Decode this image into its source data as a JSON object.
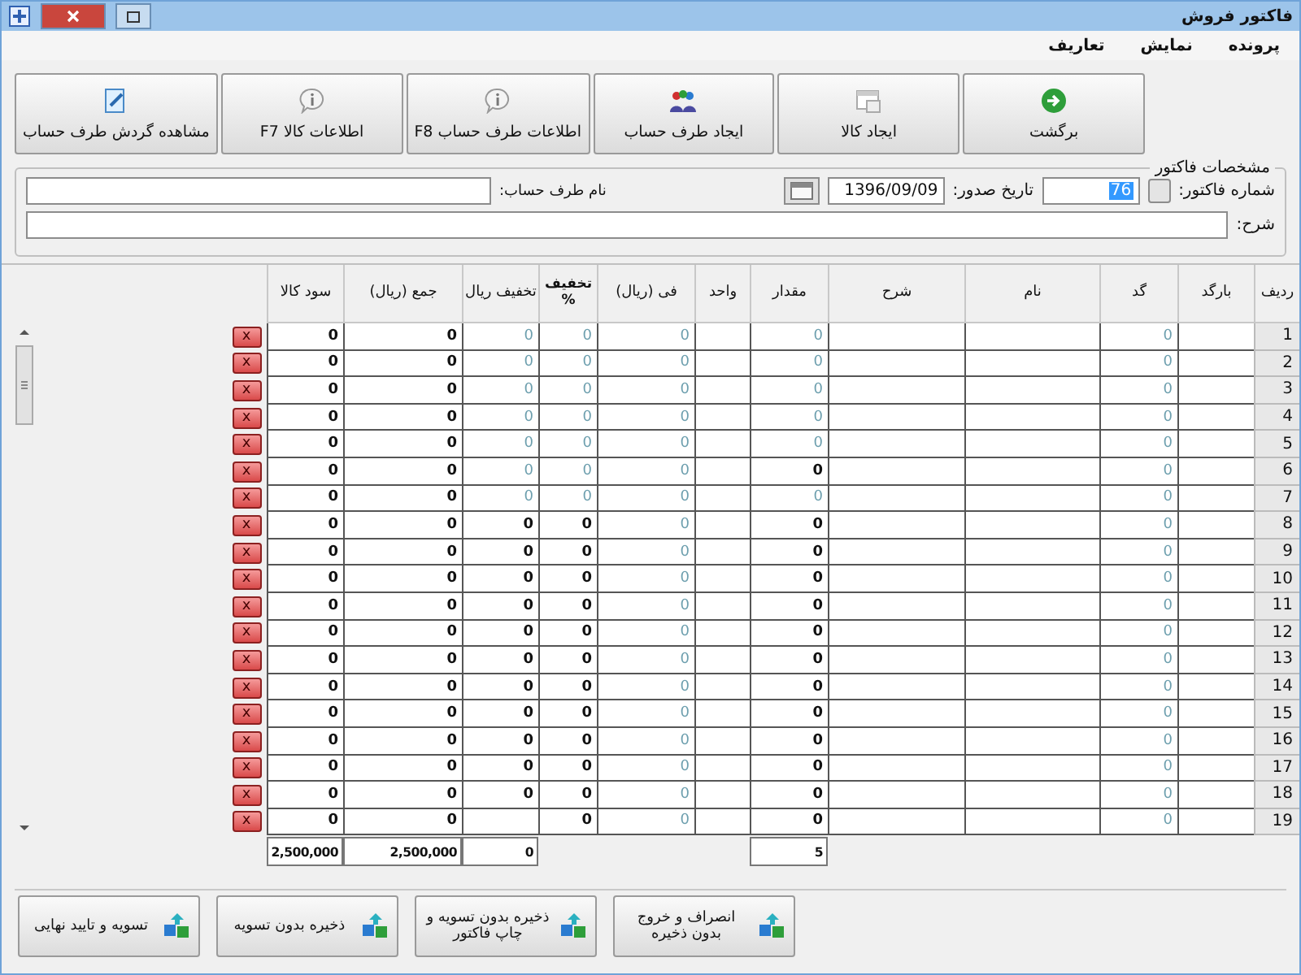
{
  "window": {
    "title": "فاکتور فروش"
  },
  "menu": [
    "پرونده",
    "نمایش",
    "تعاریف"
  ],
  "toolbar": [
    "برگشت",
    "ایجاد کالا",
    "ایجاد طرف حساب",
    "اطلاعات طرف حساب F8",
    "اطلاعات کالا F7",
    "مشاهده گردش طرف حساب"
  ],
  "invoice": {
    "legend": "مشخصات فاکتور",
    "number_label": "شماره فاکتور:",
    "number": "76",
    "number_highlighted": true,
    "date_label": "تاریخ صدور:",
    "date": "1396/09/09",
    "account_label": "نام طرف حساب:",
    "description_label": "شرح:"
  },
  "table": {
    "columns": [
      "ردیف",
      "بارگد",
      "گد",
      "نام",
      "شرح",
      "مقدار",
      "واحد",
      "فی (ریال)",
      "تخفیف %",
      "تخفیف ریال",
      "جمع (ریال)",
      "سود کالا"
    ],
    "rows": [
      {
        "delete": "x",
        "cells": [
          {
            "kind": "row_number",
            "text": "1"
          },
          {
            "kind": "empty"
          },
          {
            "kind": "value",
            "text": "0",
            "muted": true
          },
          {
            "kind": "empty"
          },
          {
            "kind": "empty"
          },
          {
            "kind": "value",
            "text": "0",
            "muted": true
          },
          {
            "kind": "empty"
          },
          {
            "kind": "value",
            "text": "0",
            "muted": true
          },
          {
            "kind": "value",
            "text": "0",
            "muted": true
          },
          {
            "kind": "value",
            "text": "0",
            "muted": true
          },
          {
            "kind": "value",
            "text": "0",
            "muted": false
          },
          {
            "kind": "value",
            "text": "0",
            "muted": false
          }
        ]
      },
      {
        "delete": "x",
        "cells": [
          {
            "kind": "row_number",
            "text": "2"
          },
          {
            "kind": "empty"
          },
          {
            "kind": "value",
            "text": "0",
            "muted": true
          },
          {
            "kind": "empty"
          },
          {
            "kind": "empty"
          },
          {
            "kind": "value",
            "text": "0",
            "muted": true
          },
          {
            "kind": "empty"
          },
          {
            "kind": "value",
            "text": "0",
            "muted": true
          },
          {
            "kind": "value",
            "text": "0",
            "muted": true
          },
          {
            "kind": "value",
            "text": "0",
            "muted": true
          },
          {
            "kind": "value",
            "text": "0",
            "muted": false
          },
          {
            "kind": "value",
            "text": "0",
            "muted": false
          }
        ]
      },
      {
        "delete": "x",
        "cells": [
          {
            "kind": "row_number",
            "text": "3"
          },
          {
            "kind": "empty"
          },
          {
            "kind": "value",
            "text": "0",
            "muted": true
          },
          {
            "kind": "empty"
          },
          {
            "kind": "empty"
          },
          {
            "kind": "value",
            "text": "0",
            "muted": true
          },
          {
            "kind": "empty"
          },
          {
            "kind": "value",
            "text": "0",
            "muted": true
          },
          {
            "kind": "value",
            "text": "0",
            "muted": true
          },
          {
            "kind": "value",
            "text": "0",
            "muted": true
          },
          {
            "kind": "value",
            "text": "0",
            "muted": false
          },
          {
            "kind": "value",
            "text": "0",
            "muted": false
          }
        ]
      },
      {
        "delete": "x",
        "cells": [
          {
            "kind": "row_number",
            "text": "4"
          },
          {
            "kind": "empty"
          },
          {
            "kind": "value",
            "text": "0",
            "muted": true
          },
          {
            "kind": "empty"
          },
          {
            "kind": "empty"
          },
          {
            "kind": "value",
            "text": "0",
            "muted": true
          },
          {
            "kind": "empty"
          },
          {
            "kind": "value",
            "text": "0",
            "muted": true
          },
          {
            "kind": "value",
            "text": "0",
            "muted": true
          },
          {
            "kind": "value",
            "text": "0",
            "muted": true
          },
          {
            "kind": "value",
            "text": "0",
            "muted": false
          },
          {
            "kind": "value",
            "text": "0",
            "muted": false
          }
        ]
      },
      {
        "delete": "x",
        "cells": [
          {
            "kind": "row_number",
            "text": "5"
          },
          {
            "kind": "empty"
          },
          {
            "kind": "value",
            "text": "0",
            "muted": true
          },
          {
            "kind": "empty"
          },
          {
            "kind": "empty"
          },
          {
            "kind": "value",
            "text": "0",
            "muted": true
          },
          {
            "kind": "empty"
          },
          {
            "kind": "value",
            "text": "0",
            "muted": true
          },
          {
            "kind": "value",
            "text": "0",
            "muted": true
          },
          {
            "kind": "value",
            "text": "0",
            "muted": true
          },
          {
            "kind": "value",
            "text": "0",
            "muted": false
          },
          {
            "kind": "value",
            "text": "0",
            "muted": false
          }
        ]
      },
      {
        "delete": "x",
        "cells": [
          {
            "kind": "row_number",
            "text": "6"
          },
          {
            "kind": "empty"
          },
          {
            "kind": "value",
            "text": "0",
            "muted": true
          },
          {
            "kind": "empty"
          },
          {
            "kind": "empty"
          },
          {
            "kind": "value",
            "text": "0",
            "muted": false
          },
          {
            "kind": "empty"
          },
          {
            "kind": "value",
            "text": "0",
            "muted": true
          },
          {
            "kind": "value",
            "text": "0",
            "muted": true
          },
          {
            "kind": "value",
            "text": "0",
            "muted": true
          },
          {
            "kind": "value",
            "text": "0",
            "muted": false
          },
          {
            "kind": "value",
            "text": "0",
            "muted": false
          }
        ]
      },
      {
        "delete": "x",
        "cells": [
          {
            "kind": "row_number",
            "text": "7"
          },
          {
            "kind": "empty"
          },
          {
            "kind": "value",
            "text": "0",
            "muted": true
          },
          {
            "kind": "empty"
          },
          {
            "kind": "empty"
          },
          {
            "kind": "value",
            "text": "0",
            "muted": true
          },
          {
            "kind": "empty"
          },
          {
            "kind": "value",
            "text": "0",
            "muted": true
          },
          {
            "kind": "value",
            "text": "0",
            "muted": true
          },
          {
            "kind": "value",
            "text": "0",
            "muted": true
          },
          {
            "kind": "value",
            "text": "0",
            "muted": false
          },
          {
            "kind": "value",
            "text": "0",
            "muted": false
          }
        ]
      },
      {
        "delete": "x",
        "cells": [
          {
            "kind": "row_number",
            "text": "8"
          },
          {
            "kind": "empty"
          },
          {
            "kind": "value",
            "text": "0",
            "muted": true
          },
          {
            "kind": "empty"
          },
          {
            "kind": "empty"
          },
          {
            "kind": "value",
            "text": "0",
            "muted": false
          },
          {
            "kind": "empty"
          },
          {
            "kind": "value",
            "text": "0",
            "muted": true
          },
          {
            "kind": "value",
            "text": "0",
            "muted": false
          },
          {
            "kind": "value",
            "text": "0",
            "muted": false
          },
          {
            "kind": "value",
            "text": "0",
            "muted": false
          },
          {
            "kind": "value",
            "text": "0",
            "muted": false
          }
        ]
      },
      {
        "delete": "x",
        "cells": [
          {
            "kind": "row_number",
            "text": "9"
          },
          {
            "kind": "empty"
          },
          {
            "kind": "value",
            "text": "0",
            "muted": true
          },
          {
            "kind": "empty"
          },
          {
            "kind": "empty"
          },
          {
            "kind": "value",
            "text": "0",
            "muted": false
          },
          {
            "kind": "empty"
          },
          {
            "kind": "value",
            "text": "0",
            "muted": true
          },
          {
            "kind": "value",
            "text": "0",
            "muted": false
          },
          {
            "kind": "value",
            "text": "0",
            "muted": false
          },
          {
            "kind": "value",
            "text": "0",
            "muted": false
          },
          {
            "kind": "value",
            "text": "0",
            "muted": false
          }
        ]
      },
      {
        "delete": "x",
        "cells": [
          {
            "kind": "row_number",
            "text": "10"
          },
          {
            "kind": "empty"
          },
          {
            "kind": "value",
            "text": "0",
            "muted": true
          },
          {
            "kind": "empty"
          },
          {
            "kind": "empty"
          },
          {
            "kind": "value",
            "text": "0",
            "muted": false
          },
          {
            "kind": "empty"
          },
          {
            "kind": "value",
            "text": "0",
            "muted": true
          },
          {
            "kind": "value",
            "text": "0",
            "muted": false
          },
          {
            "kind": "value",
            "text": "0",
            "muted": false
          },
          {
            "kind": "value",
            "text": "0",
            "muted": false
          },
          {
            "kind": "value",
            "text": "0",
            "muted": false
          }
        ]
      },
      {
        "delete": "x",
        "cells": [
          {
            "kind": "row_number",
            "text": "11"
          },
          {
            "kind": "empty"
          },
          {
            "kind": "value",
            "text": "0",
            "muted": true
          },
          {
            "kind": "empty"
          },
          {
            "kind": "empty"
          },
          {
            "kind": "value",
            "text": "0",
            "muted": false
          },
          {
            "kind": "empty"
          },
          {
            "kind": "value",
            "text": "0",
            "muted": true
          },
          {
            "kind": "value",
            "text": "0",
            "muted": false
          },
          {
            "kind": "value",
            "text": "0",
            "muted": false
          },
          {
            "kind": "value",
            "text": "0",
            "muted": false
          },
          {
            "kind": "value",
            "text": "0",
            "muted": false
          }
        ]
      },
      {
        "delete": "x",
        "cells": [
          {
            "kind": "row_number",
            "text": "12"
          },
          {
            "kind": "empty"
          },
          {
            "kind": "value",
            "text": "0",
            "muted": true
          },
          {
            "kind": "empty"
          },
          {
            "kind": "empty"
          },
          {
            "kind": "value",
            "text": "0",
            "muted": false
          },
          {
            "kind": "empty"
          },
          {
            "kind": "value",
            "text": "0",
            "muted": true
          },
          {
            "kind": "value",
            "text": "0",
            "muted": false
          },
          {
            "kind": "value",
            "text": "0",
            "muted": false
          },
          {
            "kind": "value",
            "text": "0",
            "muted": false
          },
          {
            "kind": "value",
            "text": "0",
            "muted": false
          }
        ]
      },
      {
        "delete": "x",
        "cells": [
          {
            "kind": "row_number",
            "text": "13"
          },
          {
            "kind": "empty"
          },
          {
            "kind": "value",
            "text": "0",
            "muted": true
          },
          {
            "kind": "empty"
          },
          {
            "kind": "empty"
          },
          {
            "kind": "value",
            "text": "0",
            "muted": false
          },
          {
            "kind": "empty"
          },
          {
            "kind": "value",
            "text": "0",
            "muted": true
          },
          {
            "kind": "value",
            "text": "0",
            "muted": false
          },
          {
            "kind": "value",
            "text": "0",
            "muted": false
          },
          {
            "kind": "value",
            "text": "0",
            "muted": false
          },
          {
            "kind": "value",
            "text": "0",
            "muted": false
          }
        ]
      },
      {
        "delete": "x",
        "cells": [
          {
            "kind": "row_number",
            "text": "14"
          },
          {
            "kind": "empty"
          },
          {
            "kind": "value",
            "text": "0",
            "muted": true
          },
          {
            "kind": "empty"
          },
          {
            "kind": "empty"
          },
          {
            "kind": "value",
            "text": "0",
            "muted": false
          },
          {
            "kind": "empty"
          },
          {
            "kind": "value",
            "text": "0",
            "muted": true
          },
          {
            "kind": "value",
            "text": "0",
            "muted": false
          },
          {
            "kind": "value",
            "text": "0",
            "muted": false
          },
          {
            "kind": "value",
            "text": "0",
            "muted": false
          },
          {
            "kind": "value",
            "text": "0",
            "muted": false
          }
        ]
      },
      {
        "delete": "x",
        "cells": [
          {
            "kind": "row_number",
            "text": "15"
          },
          {
            "kind": "empty"
          },
          {
            "kind": "value",
            "text": "0",
            "muted": true
          },
          {
            "kind": "empty"
          },
          {
            "kind": "empty"
          },
          {
            "kind": "value",
            "text": "0",
            "muted": false
          },
          {
            "kind": "empty"
          },
          {
            "kind": "value",
            "text": "0",
            "muted": true
          },
          {
            "kind": "value",
            "text": "0",
            "muted": false
          },
          {
            "kind": "value",
            "text": "0",
            "muted": false
          },
          {
            "kind": "value",
            "text": "0",
            "muted": false
          },
          {
            "kind": "value",
            "text": "0",
            "muted": false
          }
        ]
      },
      {
        "delete": "x",
        "cells": [
          {
            "kind": "row_number",
            "text": "16"
          },
          {
            "kind": "empty"
          },
          {
            "kind": "value",
            "text": "0",
            "muted": true
          },
          {
            "kind": "empty"
          },
          {
            "kind": "empty"
          },
          {
            "kind": "value",
            "text": "0",
            "muted": false
          },
          {
            "kind": "empty"
          },
          {
            "kind": "value",
            "text": "0",
            "muted": true
          },
          {
            "kind": "value",
            "text": "0",
            "muted": false
          },
          {
            "kind": "value",
            "text": "0",
            "muted": false
          },
          {
            "kind": "value",
            "text": "0",
            "muted": false
          },
          {
            "kind": "value",
            "text": "0",
            "muted": false
          }
        ]
      },
      {
        "delete": "x",
        "cells": [
          {
            "kind": "row_number",
            "text": "17"
          },
          {
            "kind": "empty"
          },
          {
            "kind": "value",
            "text": "0",
            "muted": true
          },
          {
            "kind": "empty"
          },
          {
            "kind": "empty"
          },
          {
            "kind": "value",
            "text": "0",
            "muted": false
          },
          {
            "kind": "empty"
          },
          {
            "kind": "value",
            "text": "0",
            "muted": true
          },
          {
            "kind": "value",
            "text": "0",
            "muted": false
          },
          {
            "kind": "value",
            "text": "0",
            "muted": false
          },
          {
            "kind": "value",
            "text": "0",
            "muted": false
          },
          {
            "kind": "value",
            "text": "0",
            "muted": false
          }
        ]
      },
      {
        "delete": "x",
        "cells": [
          {
            "kind": "row_number",
            "text": "18"
          },
          {
            "kind": "empty"
          },
          {
            "kind": "value",
            "text": "0",
            "muted": true
          },
          {
            "kind": "empty"
          },
          {
            "kind": "empty"
          },
          {
            "kind": "value",
            "text": "0",
            "muted": false
          },
          {
            "kind": "empty"
          },
          {
            "kind": "value",
            "text": "0",
            "muted": true
          },
          {
            "kind": "value",
            "text": "0",
            "muted": false
          },
          {
            "kind": "value",
            "text": "0",
            "muted": false
          },
          {
            "kind": "value",
            "text": "0",
            "muted": false
          },
          {
            "kind": "value",
            "text": "0",
            "muted": false
          }
        ]
      },
      {
        "delete": "x",
        "cells": [
          {
            "kind": "row_number",
            "text": "19"
          },
          {
            "kind": "empty"
          },
          {
            "kind": "value",
            "text": "0",
            "muted": true
          },
          {
            "kind": "empty"
          },
          {
            "kind": "empty"
          },
          {
            "kind": "value",
            "text": "0",
            "muted": false
          },
          {
            "kind": "empty"
          },
          {
            "kind": "value",
            "text": "0",
            "muted": true
          },
          {
            "kind": "value",
            "text": "0",
            "muted": false
          },
          {
            "kind": "empty"
          },
          {
            "kind": "value",
            "text": "0",
            "muted": false
          },
          {
            "kind": "value",
            "text": "0",
            "muted": false
          }
        ]
      }
    ],
    "totals": [
      {
        "kind": "empty"
      },
      {
        "kind": "empty"
      },
      {
        "kind": "empty"
      },
      {
        "kind": "empty"
      },
      {
        "kind": "empty"
      },
      {
        "kind": "value",
        "text": "5"
      },
      {
        "kind": "empty"
      },
      {
        "kind": "empty"
      },
      {
        "kind": "empty"
      },
      {
        "kind": "value",
        "text": "0"
      },
      {
        "kind": "value",
        "text": "2,500,000"
      },
      {
        "kind": "value",
        "text": "2,500,000"
      }
    ]
  },
  "actions": [
    "انصراف و خروج بدون ذخیره",
    "ذخیره بدون تسویه و چاپ فاکتور",
    "ذخیره بدون تسویه",
    "تسویه و تایید نهایی"
  ]
}
